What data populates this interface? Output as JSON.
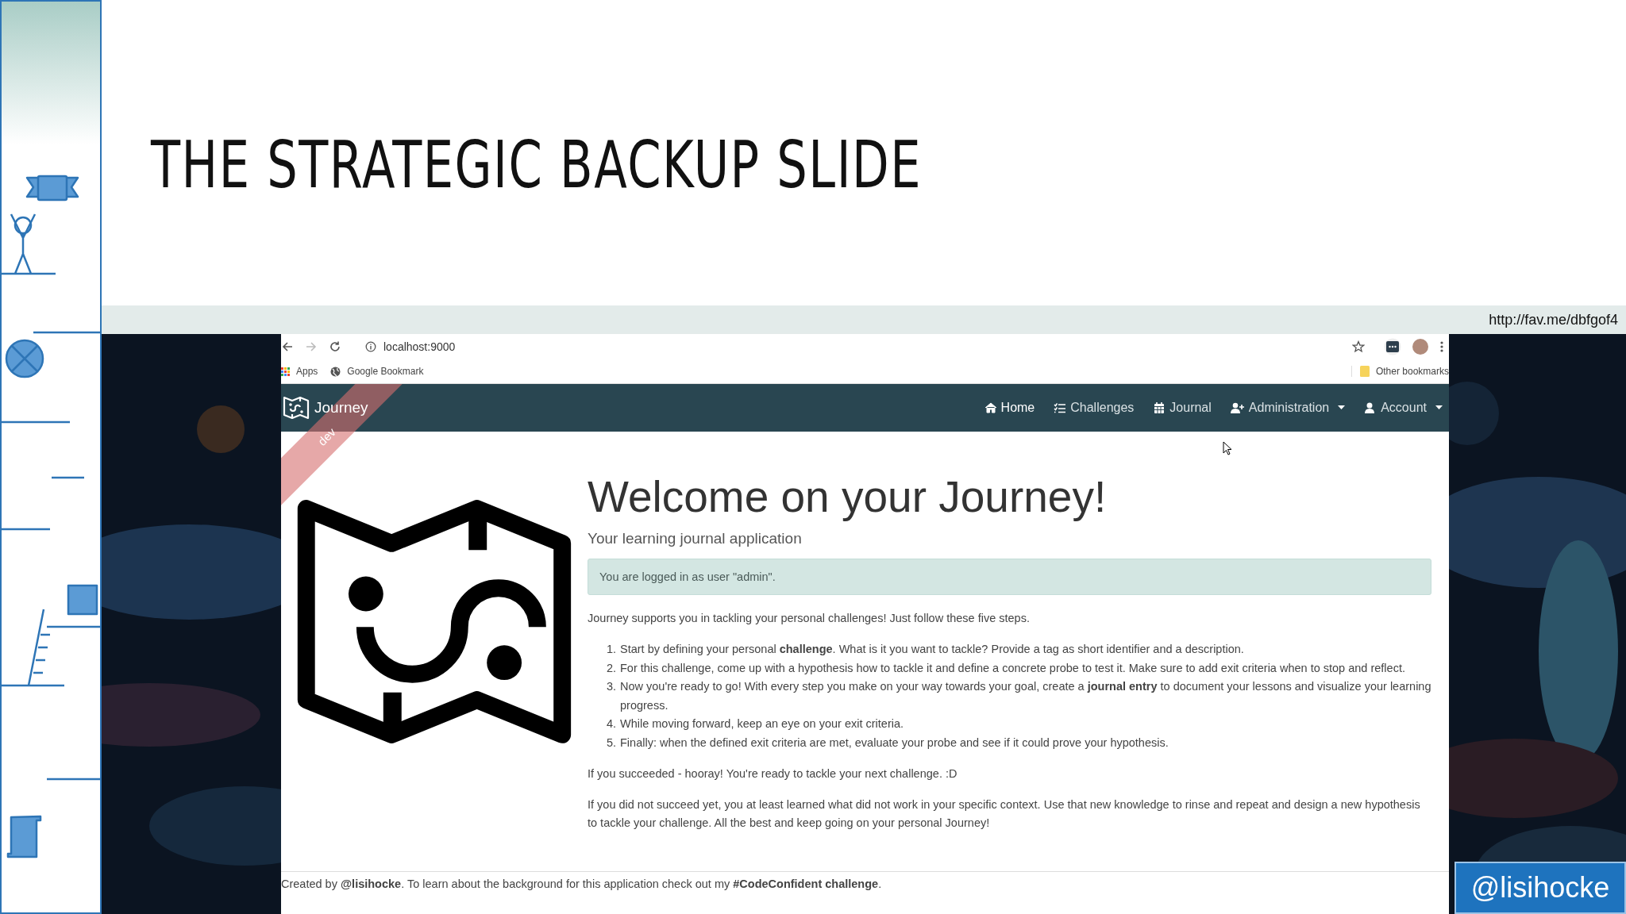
{
  "slide": {
    "title": "THE STRATEGIC BACKUP SLIDE",
    "source_link": "http://fav.me/dbfgof4",
    "handle_badge": "@lisihocke"
  },
  "browser": {
    "address": "localhost:9000",
    "bookmarks": [
      {
        "label": "Apps",
        "kind": "apps"
      },
      {
        "label": "Google Bookmark",
        "kind": "globe"
      }
    ],
    "other_bookmarks": "Other bookmarks"
  },
  "app": {
    "brand": "Journey",
    "ribbon": "dev",
    "nav": [
      {
        "label": "Home",
        "selected": true,
        "dropdown": false
      },
      {
        "label": "Challenges",
        "selected": false,
        "dropdown": false
      },
      {
        "label": "Journal",
        "selected": false,
        "dropdown": false
      },
      {
        "label": "Administration",
        "selected": false,
        "dropdown": true
      },
      {
        "label": "Account",
        "selected": false,
        "dropdown": true
      }
    ],
    "heading": "Welcome on your Journey!",
    "subheading": "Your learning journal application",
    "alert": "You are logged in as user \"admin\".",
    "intro": "Journey supports you in tackling your personal challenges! Just follow these five steps.",
    "steps": [
      {
        "number": "1.",
        "text": "Start by defining your personal **challenge**. What is it you want to tackle? Provide a tag as short identifier and a description."
      },
      {
        "number": "2.",
        "text": "For this challenge, come up with a hypothesis how to tackle it and define a concrete probe to test it. Make sure to add exit criteria when to stop and reflect."
      },
      {
        "number": "3.",
        "text": "Now you're ready to go! With every step you make on your way towards your goal, create a **journal entry** to document your lessons and visualize your learning progress."
      },
      {
        "number": "4.",
        "text": "While moving forward, keep an eye on your exit criteria."
      },
      {
        "number": "5.",
        "text": "Finally: when the defined exit criteria are met, evaluate your probe and see if it could prove your hypothesis."
      }
    ],
    "paragraphs": [
      "If you succeeded - hooray! You're ready to tackle your next challenge. :D",
      "If you did not succeed yet, you at least learned what did not work in your specific context. Use that new knowledge to rinse and repeat and design a new hypothesis to tackle your challenge. All the best and keep going on your personal Journey!"
    ],
    "footer": "Created by **@lisihocke**. To learn about the background for this application check out my **#CodeConfident challenge**."
  }
}
